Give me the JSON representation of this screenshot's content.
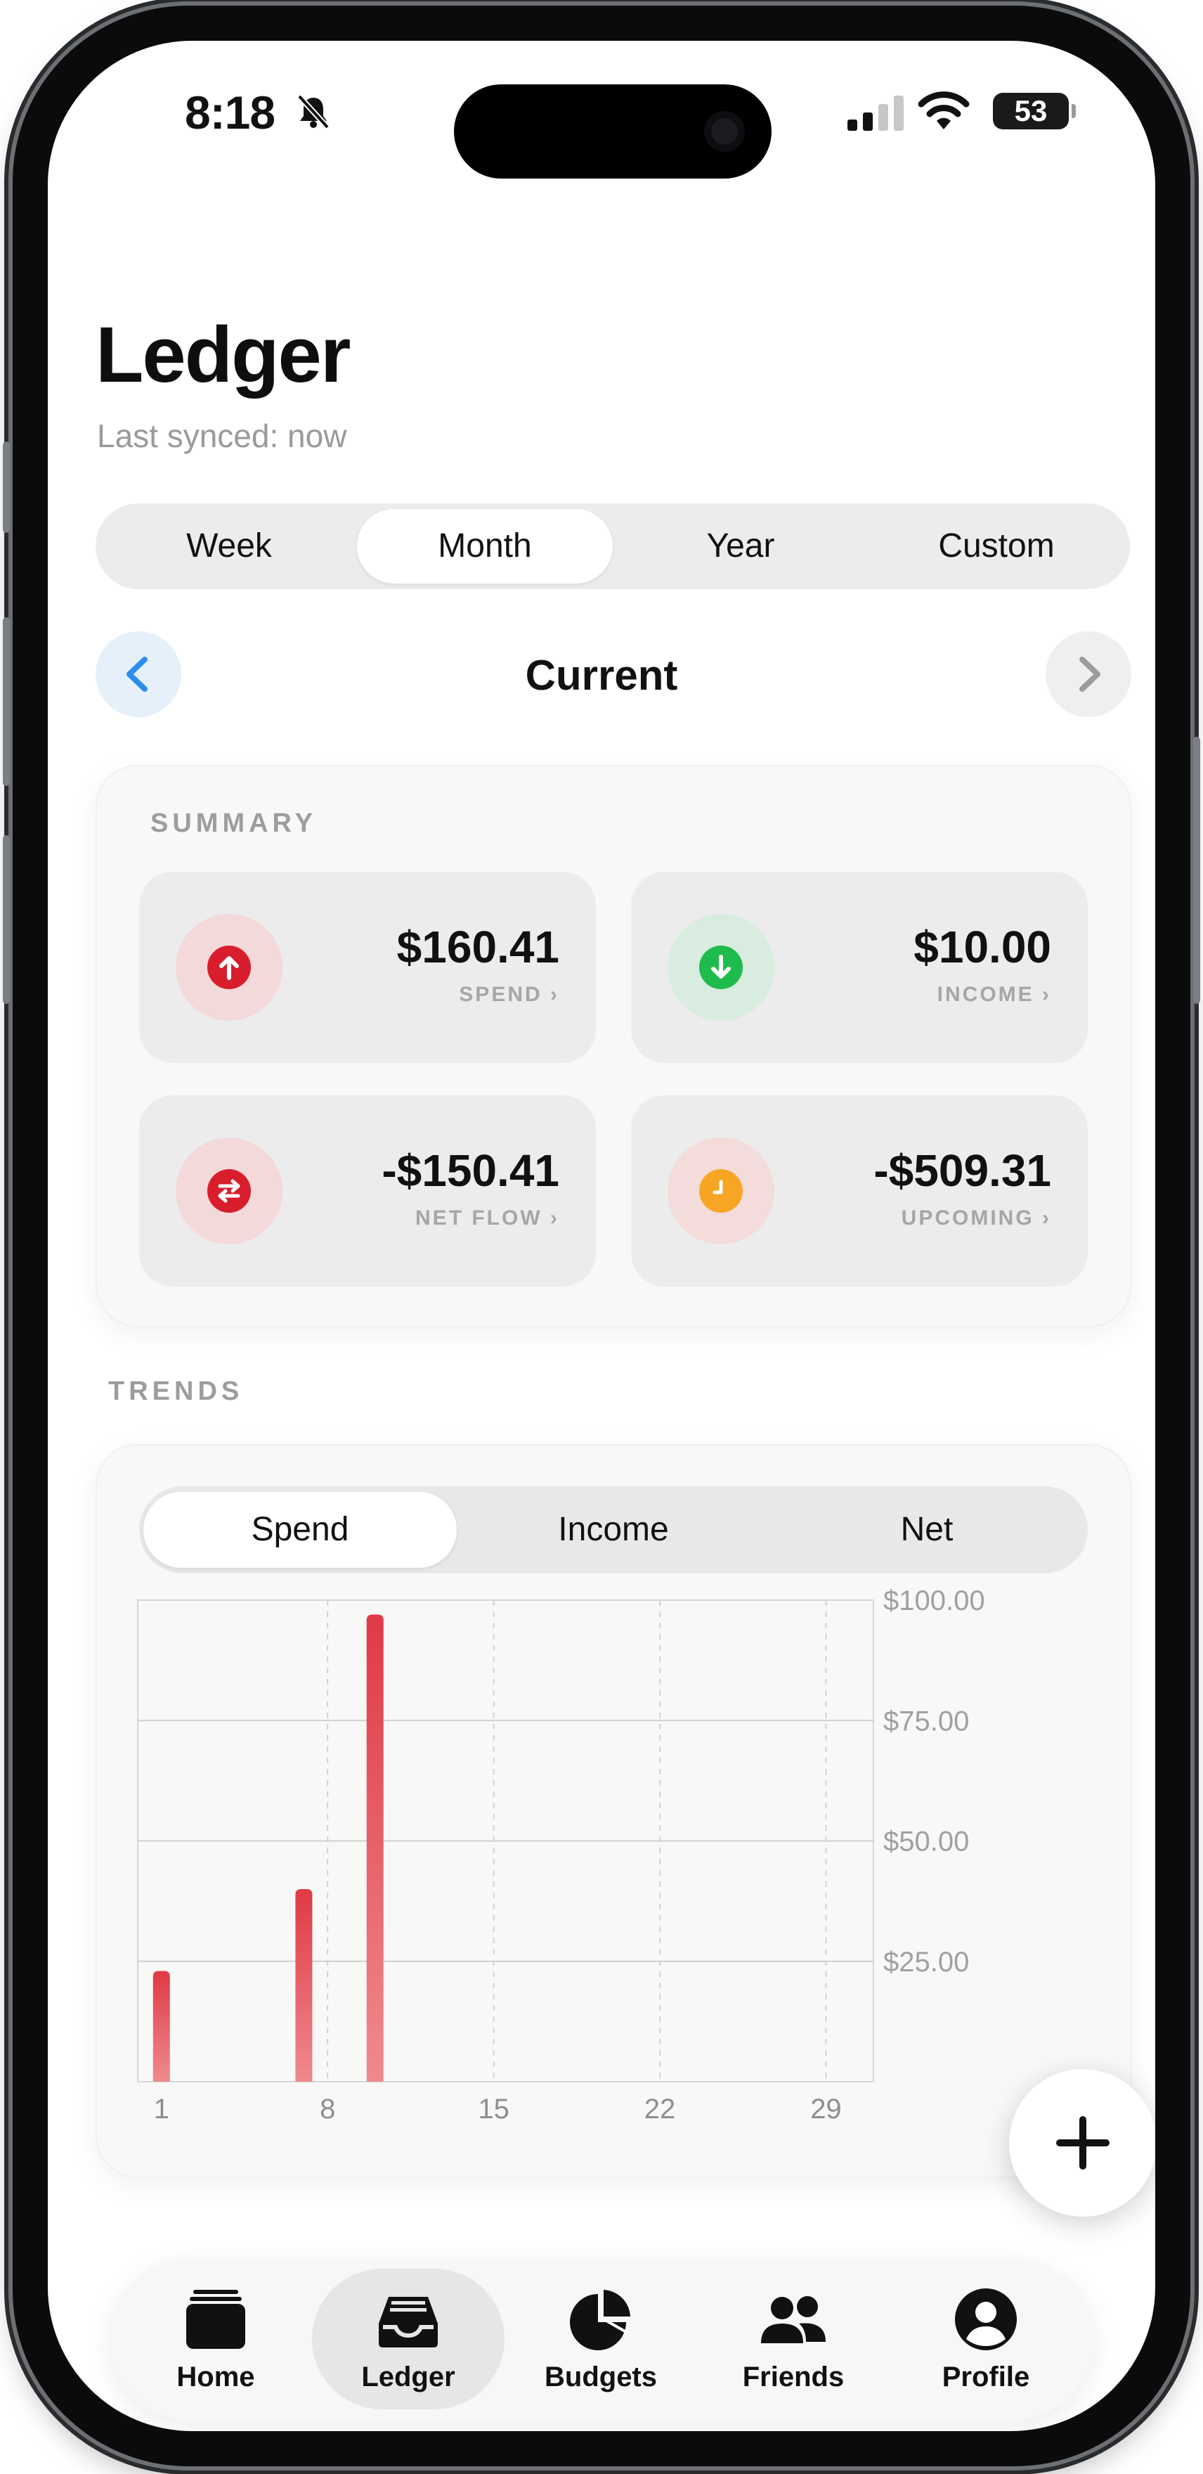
{
  "status_bar": {
    "time": "8:18",
    "battery": "53"
  },
  "header": {
    "title": "Ledger",
    "synced": "Last synced: now"
  },
  "range_tabs": [
    {
      "label": "Week"
    },
    {
      "label": "Month"
    },
    {
      "label": "Year"
    },
    {
      "label": "Custom"
    }
  ],
  "selected_range": "Month",
  "period": {
    "label": "Current"
  },
  "summary": {
    "label": "SUMMARY",
    "items": [
      {
        "value": "$160.41",
        "caption": "SPEND",
        "icon": "arrow-up-icon",
        "color": "#d81e2c",
        "bg": "#f3d9da"
      },
      {
        "value": "$10.00",
        "caption": "INCOME",
        "icon": "arrow-down-icon",
        "color": "#1fbb4c",
        "bg": "#d8ece0"
      },
      {
        "value": "-$150.41",
        "caption": "NET FLOW",
        "icon": "swap-icon",
        "color": "#d81e2c",
        "bg": "#f3d9da"
      },
      {
        "value": "-$509.31",
        "caption": "UPCOMING",
        "icon": "clock-icon",
        "color": "#f6a623",
        "bg": "#f3dcd9"
      }
    ]
  },
  "trends": {
    "label": "TRENDS",
    "tabs": [
      {
        "label": "Spend"
      },
      {
        "label": "Income"
      },
      {
        "label": "Net"
      }
    ],
    "selected_tab": "Spend"
  },
  "chart_data": {
    "type": "bar",
    "x": [
      1,
      7,
      10
    ],
    "values": [
      23,
      40,
      97
    ],
    "xticks": [
      "1",
      "8",
      "15",
      "22",
      "29"
    ],
    "xtick_values": [
      1,
      8,
      15,
      22,
      29
    ],
    "xlim": [
      0,
      31
    ],
    "yticks": [
      "$25.00",
      "$50.00",
      "$75.00",
      "$100.00"
    ],
    "ytick_values": [
      25,
      50,
      75,
      100
    ],
    "ylim": [
      0,
      100
    ],
    "grid": true,
    "color": "#e0414c"
  },
  "tabbar": [
    {
      "label": "Home",
      "icon": "home-icon"
    },
    {
      "label": "Ledger",
      "icon": "ledger-icon"
    },
    {
      "label": "Budgets",
      "icon": "pie-chart-icon"
    },
    {
      "label": "Friends",
      "icon": "friends-icon"
    },
    {
      "label": "Profile",
      "icon": "profile-icon"
    }
  ],
  "selected_tab": "Ledger",
  "colors": {
    "accent": "#2d8cf0",
    "spend": "#d81e2c",
    "income": "#1fbb4c",
    "upcoming": "#f6a623"
  }
}
